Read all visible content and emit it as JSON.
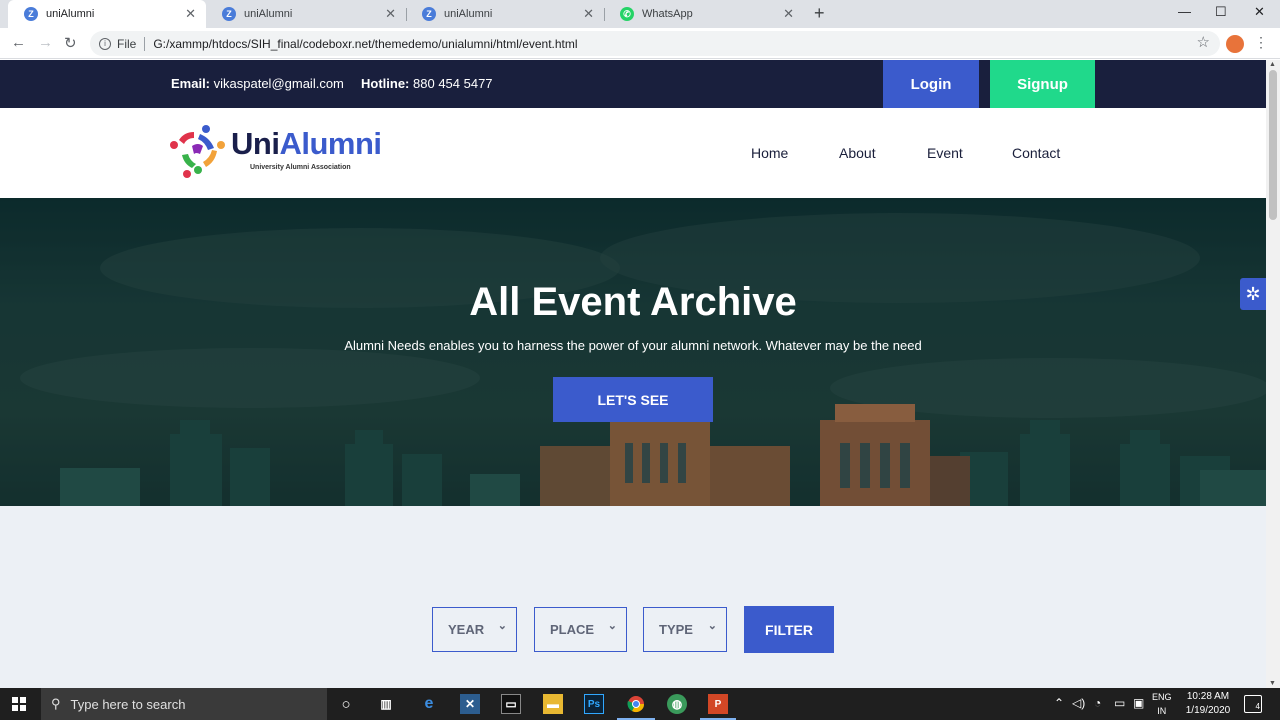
{
  "browser": {
    "tabs": [
      {
        "label": "uniAlumni",
        "icon": "Z"
      },
      {
        "label": "uniAlumni",
        "icon": "Z"
      },
      {
        "label": "uniAlumni",
        "icon": "Z"
      },
      {
        "label": "WhatsApp",
        "icon": "whatsapp-icon"
      }
    ],
    "new_tab_glyph": "+",
    "window_controls": {
      "minimize": "—",
      "maximize": "☐",
      "close": "✕"
    },
    "address": {
      "scheme_label": "File",
      "url": "G:/xammp/htdocs/SIH_final/codeboxr.net/themedemo/unialumni/html/event.html"
    }
  },
  "topbar": {
    "email_label": "Email:",
    "email_value": "vikaspatel@gmail.com",
    "hotline_label": "Hotline:",
    "hotline_value": "880 454 5477",
    "login": "Login",
    "signup": "Signup"
  },
  "header": {
    "logo_part1": "Uni",
    "logo_part2": "Alumni",
    "logo_tagline": "University Alumni Association",
    "nav": [
      "Home",
      "About",
      "Event",
      "Contact"
    ]
  },
  "hero": {
    "title": "All Event Archive",
    "subtitle": "Alumni Needs enables you to harness the power of your alumni network. Whatever may be the need",
    "button": "LET'S SEE"
  },
  "filters": {
    "year": "YEAR",
    "place": "PLACE",
    "type": "TYPE",
    "button": "FILTER"
  },
  "taskbar": {
    "search_placeholder": "Type here to search",
    "lang_1": "ENG",
    "lang_2": "IN",
    "time": "10:28 AM",
    "date": "1/19/2020",
    "notification_count": "4"
  },
  "colors": {
    "primary": "#3b5bcc",
    "signup": "#20d98b",
    "topbar": "#191f3d",
    "page_bg": "#ecf0f5"
  }
}
